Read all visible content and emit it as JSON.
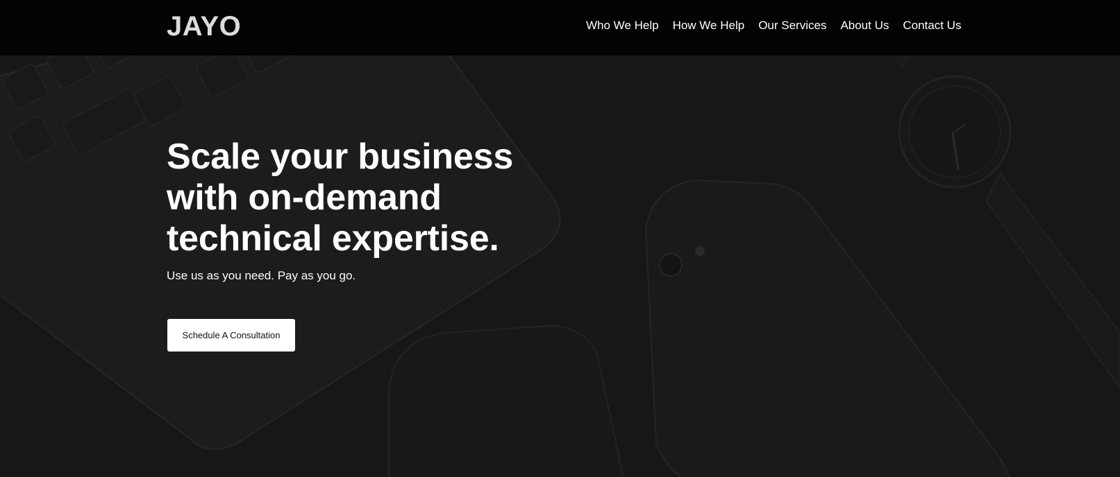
{
  "header": {
    "logo": "JAYO",
    "nav": [
      "Who We Help",
      "How We Help",
      "Our Services",
      "About Us",
      "Contact Us"
    ]
  },
  "hero": {
    "title_lines": [
      "Scale your business",
      "with on-demand",
      "technical expertise."
    ],
    "subtitle": "Use us as you need. Pay as you go.",
    "cta_label": "Schedule A Consultation"
  },
  "colors": {
    "header_bg": "#030303",
    "hero_bg": "#161616",
    "text": "#ffffff",
    "logo": "#dcdcdc",
    "button_bg": "#ffffff",
    "button_text": "#111111"
  }
}
